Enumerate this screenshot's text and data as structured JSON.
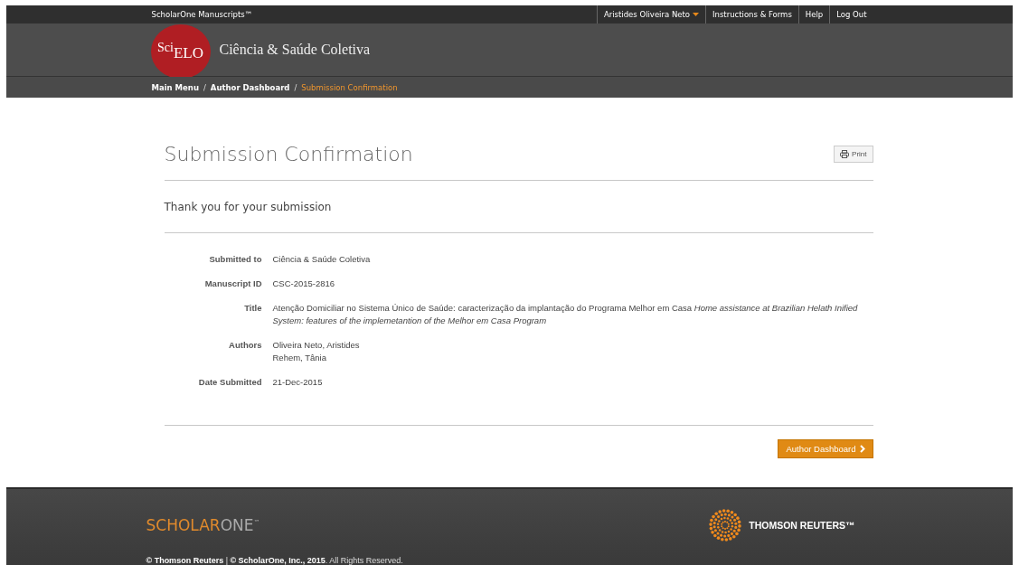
{
  "top_bar": {
    "product": "ScholarOne Manuscripts™",
    "menu": [
      {
        "label": "Aristides Oliveira Neto",
        "kind": "dropdown"
      },
      {
        "label": "Instructions & Forms",
        "kind": "link"
      },
      {
        "label": "Help",
        "kind": "link"
      },
      {
        "label": "Log Out",
        "kind": "link"
      }
    ]
  },
  "header": {
    "logo": {
      "part_1": "Sci",
      "part_2": "ELO"
    },
    "journal": "Ciência & Saúde Coletiva"
  },
  "breadcrumb": {
    "separator": "/",
    "items": [
      {
        "label": "Main Menu",
        "selected": false
      },
      {
        "label": "Author Dashboard",
        "selected": false
      },
      {
        "label": "Submission Confirmation",
        "selected": true
      }
    ]
  },
  "page": {
    "title": "Submission Confirmation",
    "print_button": "Print",
    "message": "Thank you for your submission",
    "details": [
      {
        "label": "Submitted to",
        "lines": [
          "Ciência & Saúde Coletiva"
        ]
      },
      {
        "label": "Manuscript ID",
        "lines": [
          "CSC-2015-2816"
        ]
      },
      {
        "label": "Title",
        "lines": [
          "Atenção Domiciliar no Sistema Único de Saúde: caracterização da implantação do Programa Melhor em Casa *Home assistance at Brazilian Helath Inified System: features of the implemetantion of the Melhor em Casa Program*"
        ]
      },
      {
        "label": "Authors",
        "lines": [
          "Oliveira Neto, Aristides",
          "Rehem, Tânia"
        ]
      },
      {
        "label": "Date Submitted",
        "lines": [
          "21-Dec-2015"
        ]
      }
    ],
    "next_button": "Author Dashboard"
  },
  "footer": {
    "brand_part_1": "SCHOLAR",
    "brand_part_2": "ONE",
    "brand_tm": "™",
    "partner": "THOMSON REUTERS™",
    "copyright": "**© Thomson Reuters** |  **© ScholarOne, Inc., 2015**. All Rights Reserved."
  }
}
